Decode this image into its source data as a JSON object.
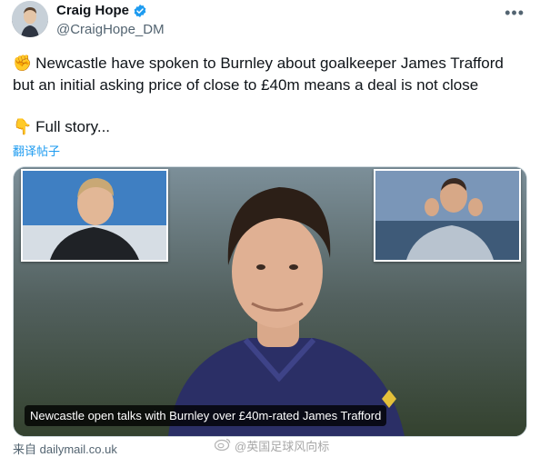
{
  "tweet": {
    "author_name": "Craig Hope",
    "author_handle": "@CraigHope_DM",
    "text_line1": "Newcastle have spoken to Burnley about goalkeeper James Trafford",
    "text_line2": "but an initial asking price of close to £40m means a deal is not close",
    "lead_emoji": "✊",
    "story_emoji": "👇",
    "story_text": "Full story...",
    "translate_label": "翻译帖子",
    "more_icon": "more-icon"
  },
  "card": {
    "caption": "Newcastle open talks with Burnley over £40m-rated James Trafford",
    "source": "来自 dailymail.co.uk"
  },
  "watermark": {
    "text": "@英国足球风向标"
  },
  "colors": {
    "verified": "#1d9bf0",
    "link": "#1d9bf0",
    "secondary": "#536471"
  }
}
